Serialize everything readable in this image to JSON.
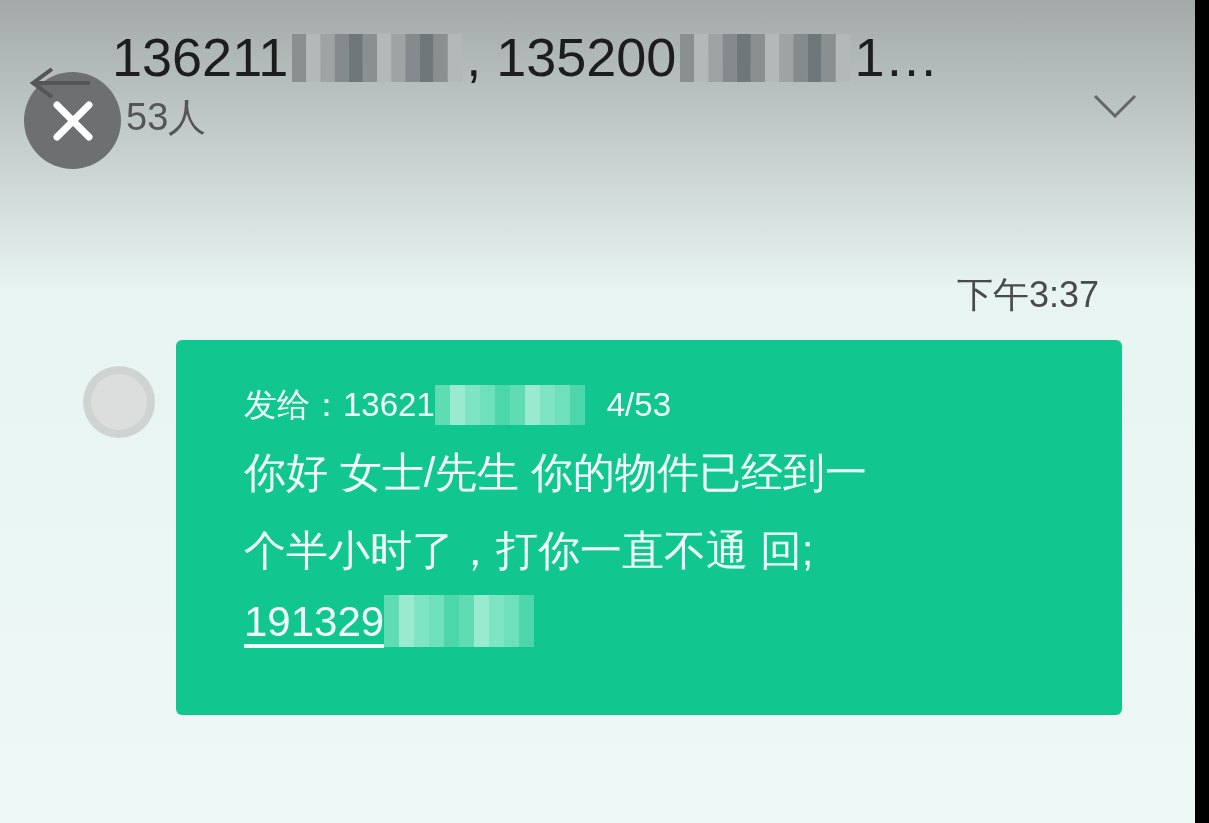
{
  "header": {
    "title_parts": [
      {
        "kind": "text",
        "text": "136211"
      },
      {
        "kind": "redacted"
      },
      {
        "kind": "text",
        "text": ", 135200"
      },
      {
        "kind": "redacted"
      },
      {
        "kind": "text",
        "text": " 1…"
      }
    ],
    "member_count": "53人"
  },
  "message": {
    "time": "下午3:37",
    "recipient_label": "发给：13621",
    "counter": "4/53",
    "lines": [
      "你好 女士/先生 你的物件已经到一",
      "个半小时了，打你一直不通 回;"
    ],
    "link": "191329"
  }
}
